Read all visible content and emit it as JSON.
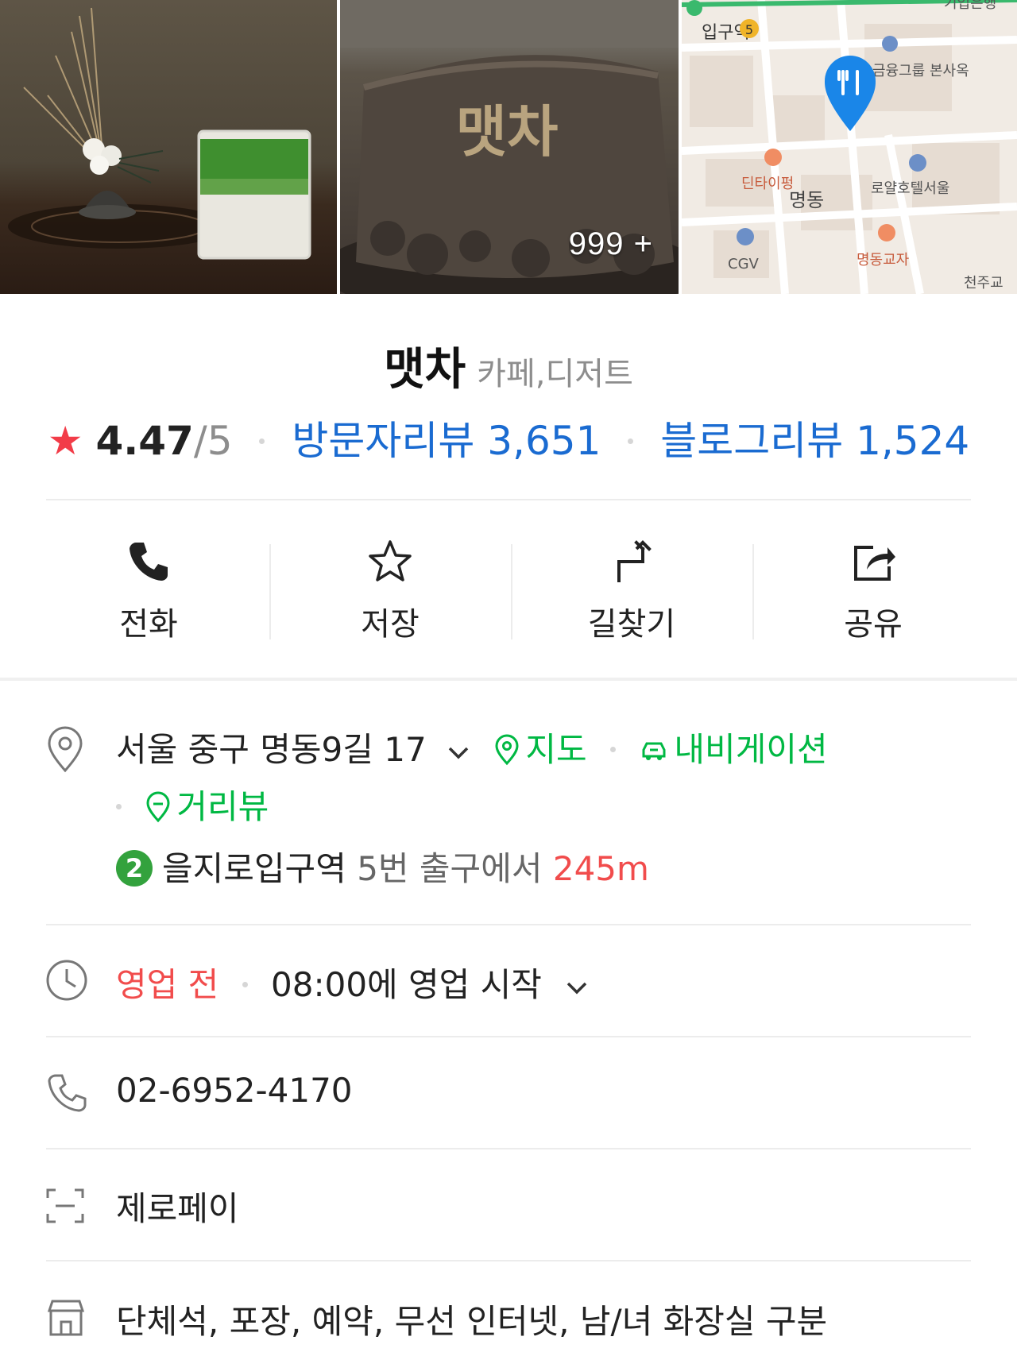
{
  "photos": {
    "photo2_sign": "맷차",
    "more_count": "999 +",
    "map_labels": {
      "station": "입구역",
      "exit_no": "5",
      "bank_hq": "금융그룹 본사옥",
      "cafe1": "딘타이펑",
      "area": "명동",
      "hotel": "로얄호텔서울",
      "cinema": "CGV",
      "restaurant": "명동교자",
      "church": "천주교",
      "top_right": "기업은행"
    }
  },
  "place": {
    "name": "맷차",
    "category": "카페,디저트",
    "rating": "4.47",
    "rating_max": "/5",
    "visitor_review": "방문자리뷰 3,651",
    "blog_review": "블로그리뷰 1,524"
  },
  "actions": [
    {
      "label": "전화",
      "icon": "phone-icon"
    },
    {
      "label": "저장",
      "icon": "star-outline-icon"
    },
    {
      "label": "길찾기",
      "icon": "directions-icon"
    },
    {
      "label": "공유",
      "icon": "share-icon"
    }
  ],
  "address": {
    "text": "서울 중구 명동9길 17",
    "map_link": "지도",
    "nav_link": "내비게이션",
    "street_link": "거리뷰",
    "subway_line": "2",
    "station": "을지로입구역",
    "exit_text": "5번 출구에서",
    "distance": "245m"
  },
  "hours": {
    "status": "영업 전",
    "detail": "08:00에 영업 시작"
  },
  "phone": "02-6952-4170",
  "pay": "제로페이",
  "amenities": "단체석, 포장, 예약, 무선 인터넷, 남/녀 화장실 구분",
  "colors": {
    "accent_blue": "#1a6bd1",
    "link_green": "#00b843",
    "status_red": "#f14c4c",
    "star_red": "#f23c48",
    "subway_line2": "#33a23d"
  }
}
